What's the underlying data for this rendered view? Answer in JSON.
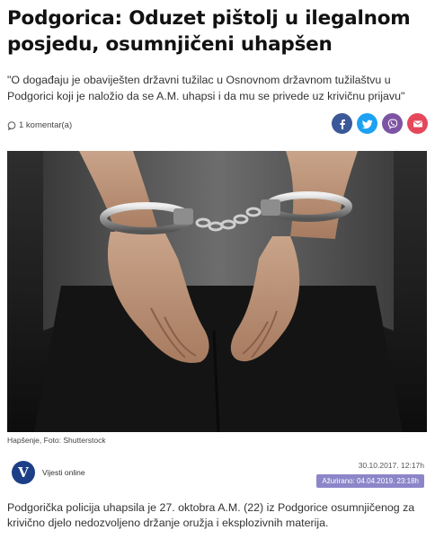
{
  "article": {
    "title": "Podgorica: Oduzet pištolj u ilegalnom posjedu, osumnjičeni uhapšen",
    "lead": "\"O događaju je obaviješten državni tužilac u Osnovnom državnom tužilaštvu u Podgorici koji je naložio da se A.M. uhapsi i da mu se privede uz krivičnu prijavu\"",
    "comments": "1 komentar(a)",
    "photo_caption": "Hapšenje, Foto: Shutterstock",
    "author": "Vijesti online",
    "author_logo_letter": "V",
    "date": "30.10.2017. 12:17h",
    "updated": "Ažurirano: 04.04.2019. 23:18h",
    "body": "Podgorička policija uhapsila je 27. oktobra A.M. (22) iz Podgorice osumnjičenog za krivično djelo nedozvoljeno držanje oružja i eksplozivnih materija."
  },
  "share": [
    {
      "icon": "facebook-icon",
      "color": "#3b5998"
    },
    {
      "icon": "twitter-icon",
      "color": "#1da1f2"
    },
    {
      "icon": "viber-icon",
      "color": "#7d54a3"
    },
    {
      "icon": "email-icon",
      "color": "#e4485a"
    }
  ],
  "colors": {
    "updated_badge": "#8c86c8",
    "brand": "#1d3f87"
  }
}
